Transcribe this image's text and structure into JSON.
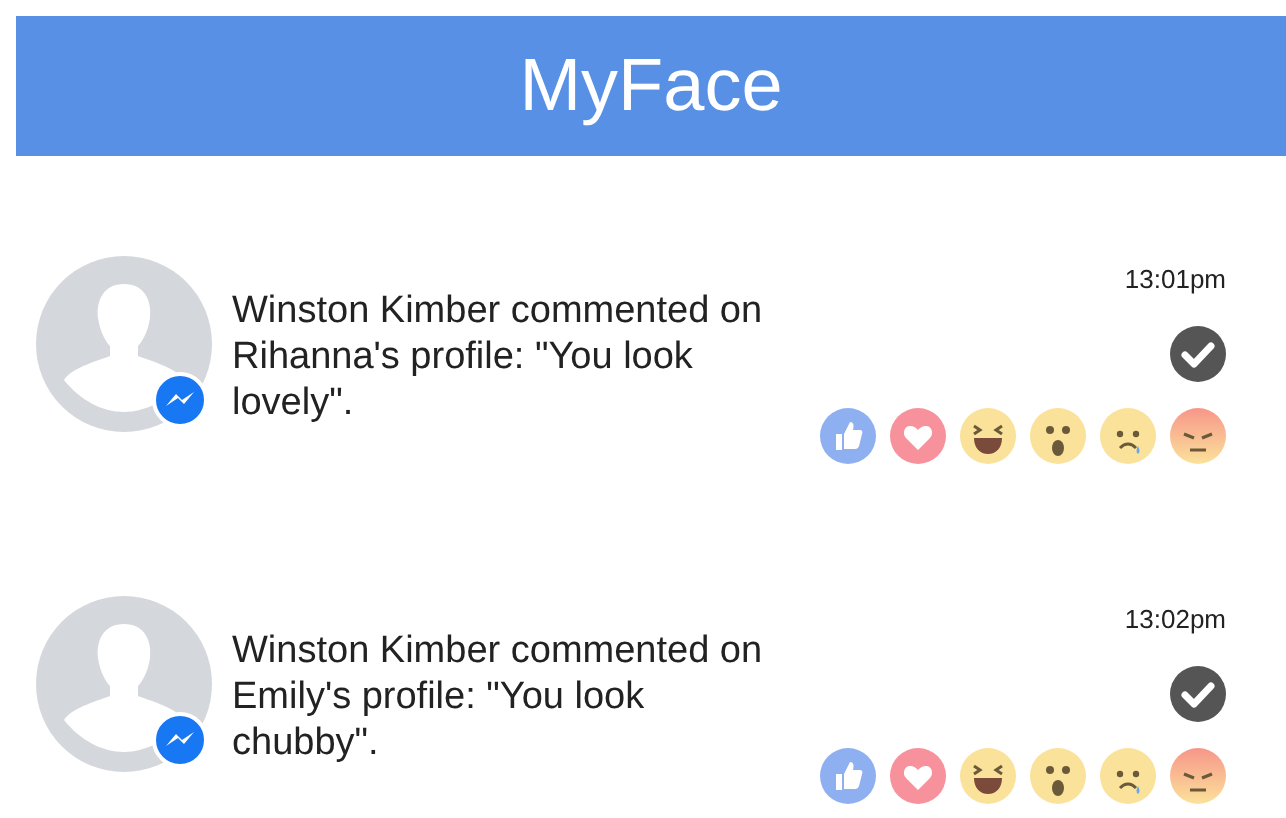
{
  "header": {
    "title": "MyFace"
  },
  "notifications": [
    {
      "text": "Winston Kimber commented on Rihanna's profile: \"You look lovely\".",
      "time": "13:01pm"
    },
    {
      "text": "Winston Kimber commented on Emily's profile: \"You look chubby\".",
      "time": "13:02pm"
    }
  ]
}
